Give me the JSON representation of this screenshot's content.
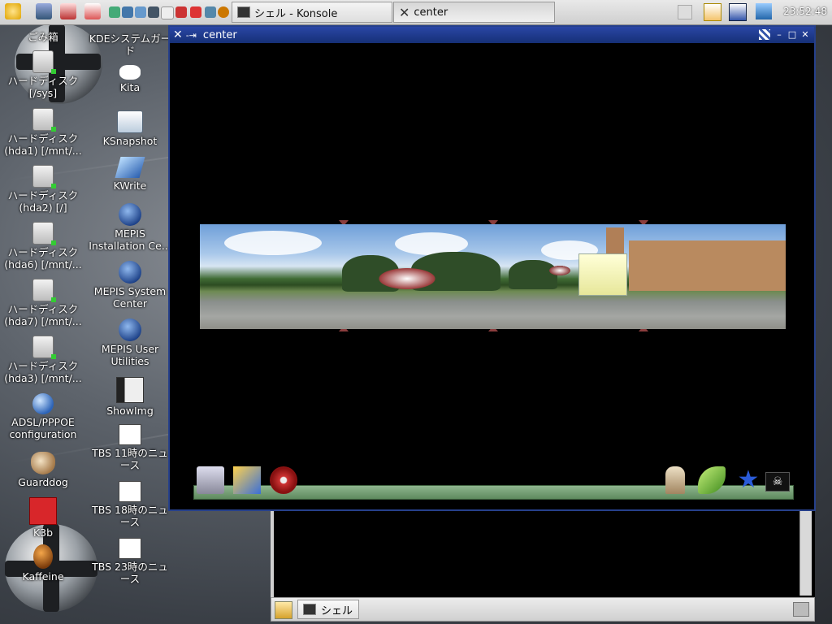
{
  "top_panel": {
    "tasks": [
      {
        "label": "シェル - Konsole"
      },
      {
        "label": "center"
      }
    ],
    "clock": "23:52:48"
  },
  "desktop_icons": [
    {
      "label": "ごみ箱"
    },
    {
      "label": "KDEシステムガード"
    },
    {
      "label": "ハードディスク [/sys]"
    },
    {
      "label": "Kita"
    },
    {
      "label": "ハードディスク (hda1) [/mnt/..."
    },
    {
      "label": "KSnapshot"
    },
    {
      "label": "ハードディスク (hda2) [/]"
    },
    {
      "label": "KWrite"
    },
    {
      "label": "ハードディスク (hda6) [/mnt/..."
    },
    {
      "label": "MEPIS Installation Ce..."
    },
    {
      "label": "ハードディスク (hda7) [/mnt/..."
    },
    {
      "label": "MEPIS System Center"
    },
    {
      "label": "ハードディスク (hda3) [/mnt/..."
    },
    {
      "label": "MEPIS User Utilities"
    },
    {
      "label": "ADSL/PPPOE configuration"
    },
    {
      "label": "ShowImg"
    },
    {
      "label": "Guarddog"
    },
    {
      "label": "TBS 11時のニュース"
    },
    {
      "label": "K3b"
    },
    {
      "label": "TBS 18時のニュース"
    },
    {
      "label": "Kaffeine"
    },
    {
      "label": "TBS 23時のニュース"
    }
  ],
  "window": {
    "title": "center"
  },
  "konsole": {
    "tab_label": "シェル"
  },
  "icons": {
    "kde_menu": "kde-gear-icon",
    "home": "home-icon",
    "terminal": "terminal-icon"
  }
}
